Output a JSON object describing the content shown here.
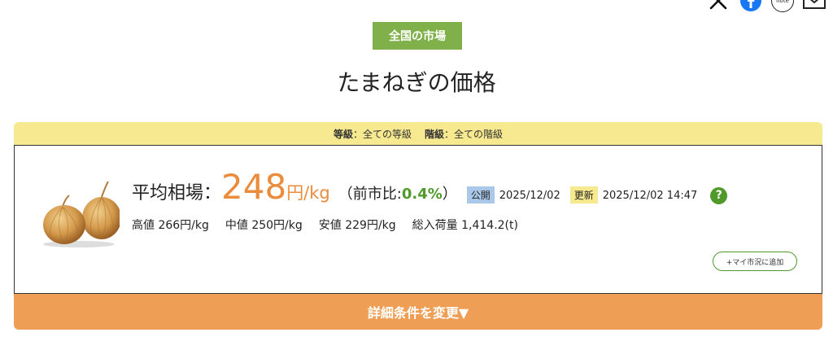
{
  "share": {
    "x_icon": "x-icon",
    "facebook_icon": "facebook-icon",
    "note_label": "note",
    "mail_icon": "mail-icon"
  },
  "badge": "全国の市場",
  "title": "たまねぎの価格",
  "filters": {
    "grade_label": "等級",
    "grade_value": "：全ての等級",
    "class_label": "階級",
    "class_value": "：全ての階級"
  },
  "price_info": {
    "label": "平均相場：",
    "price": "248",
    "unit": "円/kg",
    "prev_open": "（前市比:",
    "prev_pct": "0.4%",
    "prev_close": "）",
    "published_tag": "公開",
    "published_date": "2025/12/02",
    "updated_tag": "更新",
    "updated_date": "2025/12/02 14:47",
    "help": "?"
  },
  "stats": {
    "high": "高値 266円/kg",
    "mid": "中値 250円/kg",
    "low": "安値 229円/kg",
    "volume": "総入荷量 1,414.2(t)"
  },
  "add_button": "+マイ市況に追加",
  "detail_button": "詳細条件を変更▼",
  "colors": {
    "badge_green": "#7fb04a",
    "price_orange": "#ea8c3c",
    "filter_yellow": "#f6e98f",
    "detail_orange": "#ef9f55",
    "pct_green": "#4f9a2b",
    "published_blue": "#aac8ea"
  }
}
